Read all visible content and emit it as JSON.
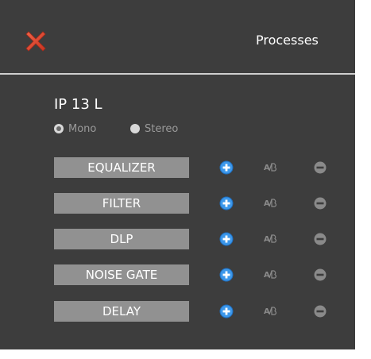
{
  "header": {
    "close_icon": "close-x-icon",
    "title": "Processes"
  },
  "device": {
    "name": "IP 13 L",
    "channel_mode": {
      "options": [
        "Mono",
        "Stereo"
      ],
      "selected": "Mono"
    }
  },
  "processes": [
    {
      "label": "EQUALIZER",
      "icons": [
        "add-icon",
        "ab-compare-icon",
        "remove-icon"
      ]
    },
    {
      "label": "FILTER",
      "icons": [
        "add-icon",
        "ab-compare-icon",
        "remove-icon"
      ]
    },
    {
      "label": "DLP",
      "icons": [
        "add-icon",
        "ab-compare-icon",
        "remove-icon"
      ]
    },
    {
      "label": "NOISE GATE",
      "icons": [
        "add-icon",
        "ab-compare-icon",
        "remove-icon"
      ]
    },
    {
      "label": "DELAY",
      "icons": [
        "add-icon",
        "ab-compare-icon",
        "remove-icon"
      ]
    }
  ],
  "colors": {
    "background": "#3d3d3d",
    "close_red": "#e0442c",
    "process_button": "#919191",
    "add_blue": "#3c97ea",
    "muted_icon": "#8a8a8a"
  }
}
